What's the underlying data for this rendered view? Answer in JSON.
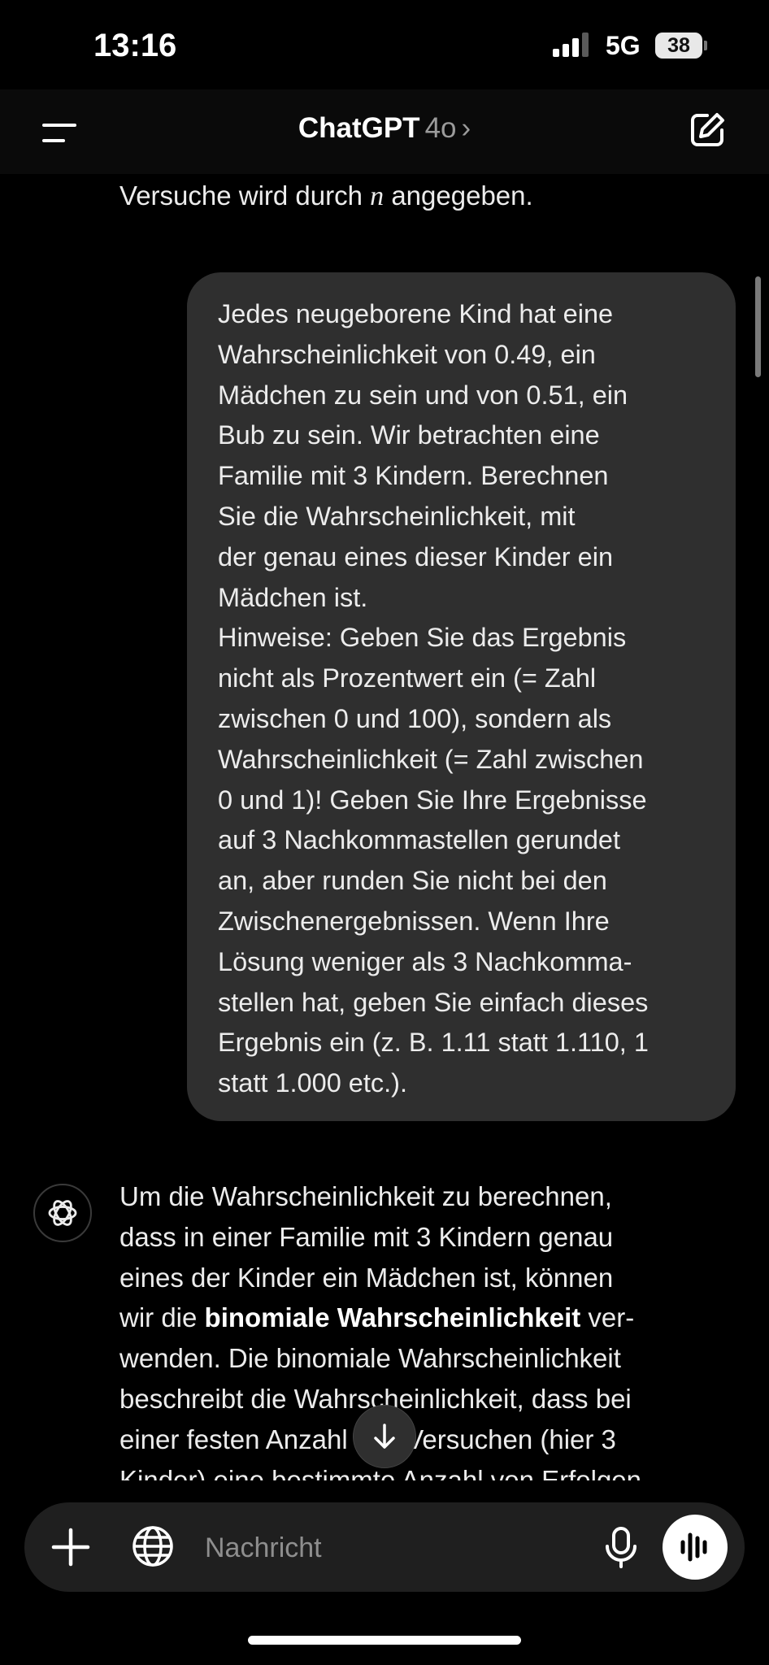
{
  "status_bar": {
    "time": "13:16",
    "network": "5G",
    "battery": "38"
  },
  "nav": {
    "brand": "ChatGPT",
    "model": "4o",
    "chevron": "›"
  },
  "previous_message": {
    "text_before": "Versuche wird durch ",
    "math_var": "n",
    "text_after": " angegeben."
  },
  "user_message": {
    "lines": [
      "Jedes neugeborene Kind hat eine",
      "Wahrscheinlichkeit von 0.49, ein",
      "Mädchen zu sein und von 0.51, ein",
      "Bub zu sein. Wir betrachten eine",
      "Familie mit 3 Kindern. Berechnen",
      "Sie die Wahrscheinlichkeit, mit",
      "der genau eines dieser Kinder ein",
      "Mädchen ist.",
      "Hinweise: Geben Sie das Ergebnis",
      "nicht als Prozentwert ein (= Zahl",
      "zwischen 0 und 100), sondern als",
      "Wahrscheinlichkeit (= Zahl zwischen",
      "0 und 1)! Geben Sie Ihre Ergebnisse",
      "auf 3 Nachkommastellen gerundet",
      "an, aber runden Sie nicht bei den",
      "Zwischenergebnissen. Wenn Ihre",
      "Lösung weniger als 3 Nachkomma-",
      "stellen hat, geben Sie einfach dieses",
      "Ergebnis ein (z. B. 1.11 statt 1.110, 1",
      "statt 1.000 etc.)."
    ]
  },
  "assistant_message": {
    "line1": "Um die Wahrscheinlichkeit zu berechnen,",
    "line2": "dass in einer Familie mit 3 Kindern genau",
    "line3": "eines der Kinder ein Mädchen ist, können",
    "line4_before": "wir die ",
    "line4_bold": "binomiale Wahrscheinlichkeit",
    "line4_after": " ver-",
    "line5": "wenden. Die binomiale Wahrscheinlichkeit",
    "line6": "beschreibt die Wahrscheinlichkeit, dass bei",
    "line7": "einer festen Anzahl von Versuchen (hier 3",
    "line8": "Kinder) eine bestimmte Anzahl von Erfolgen"
  },
  "composer": {
    "placeholder": "Nachricht"
  },
  "icons": {
    "menu": "menu-icon",
    "new_chat": "new-chat-icon",
    "avatar": "openai-logo-icon",
    "scroll_down": "arrow-down-icon",
    "plus": "plus-icon",
    "globe": "globe-icon",
    "mic": "microphone-icon",
    "voice": "voice-waveform-icon"
  },
  "colors": {
    "background": "#000000",
    "bubble": "#2f2f2f",
    "composer": "#1f1f1f",
    "text": "#ececec",
    "muted": "#8e8e8e"
  }
}
